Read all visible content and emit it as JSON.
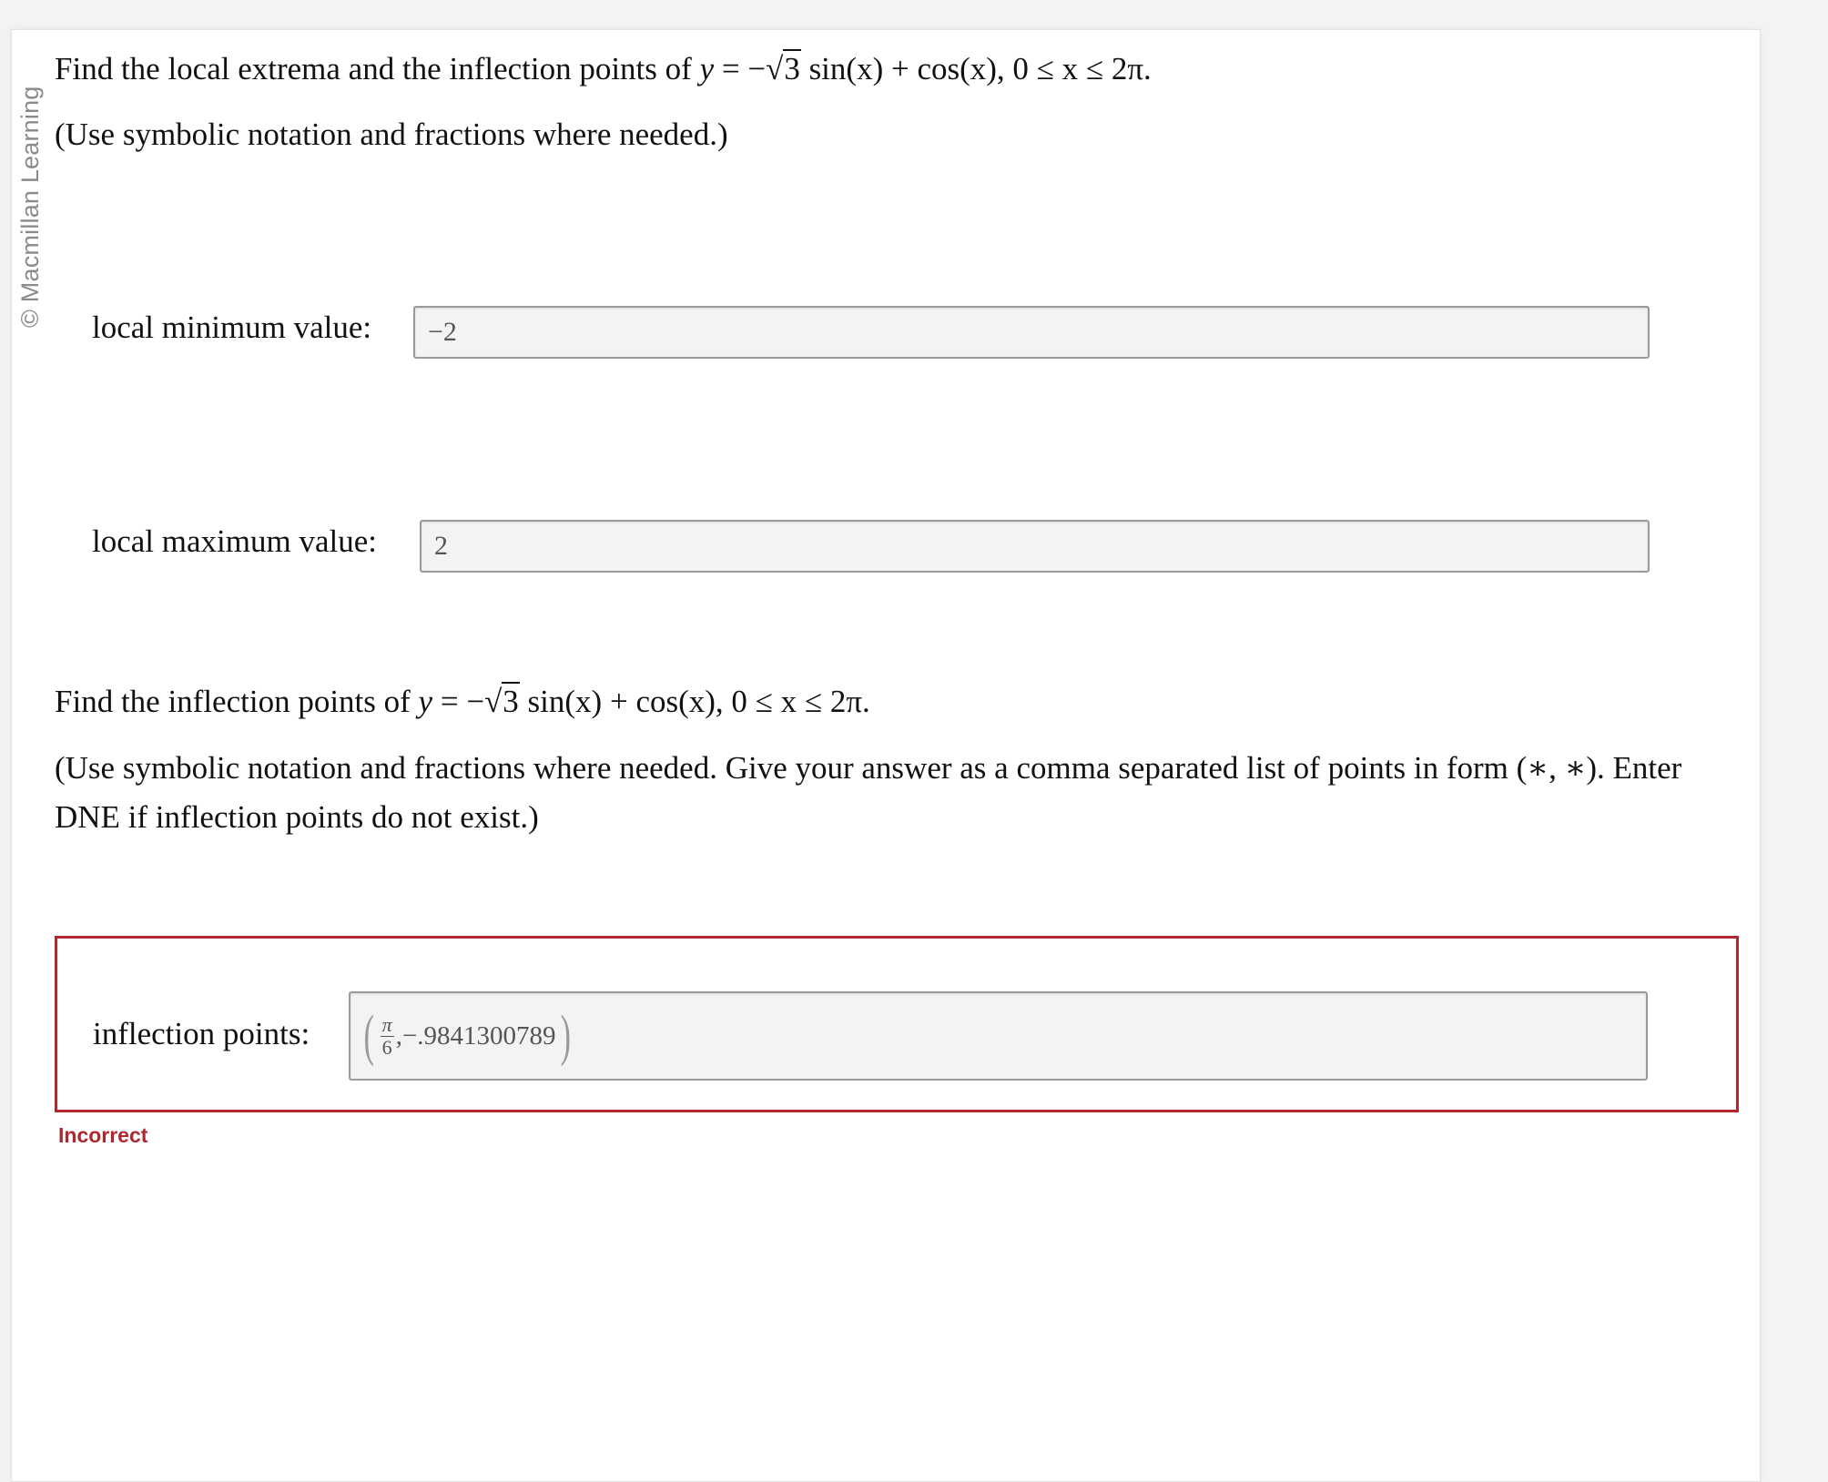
{
  "watermark": "© Macmillan Learning",
  "question1": {
    "text": "Find the local extrema and the inflection points of",
    "formula": {
      "lhs": "y",
      "eq": " = −",
      "radicand": "3",
      "rest": " sin(x) + cos(x), 0 ≤ x ≤ 2π."
    },
    "instruction": "(Use symbolic notation and fractions where needed.)"
  },
  "fields": {
    "local_min": {
      "label": "local minimum value:",
      "value": "−2"
    },
    "local_max": {
      "label": "local maximum value:",
      "value": "2"
    }
  },
  "question2": {
    "text": "Find the inflection points of",
    "formula": {
      "lhs": "y",
      "eq": " = −",
      "radicand": "3",
      "rest": " sin(x) + cos(x), 0 ≤ x ≤ 2π."
    },
    "instruction_line1": "(Use symbolic notation and fractions where needed. Give your answer as a comma separated list of points in form (∗, ∗). Enter",
    "instruction_line2": "DNE if inflection points do not exist.)"
  },
  "inflection": {
    "label": "inflection points:",
    "value": {
      "open": "(",
      "num": "π",
      "den": "6",
      "rest": ",−.9841300789",
      "close": ")"
    },
    "status": "Incorrect"
  },
  "colors": {
    "error": "#b0282f",
    "field_bg": "#f3f3f3"
  }
}
